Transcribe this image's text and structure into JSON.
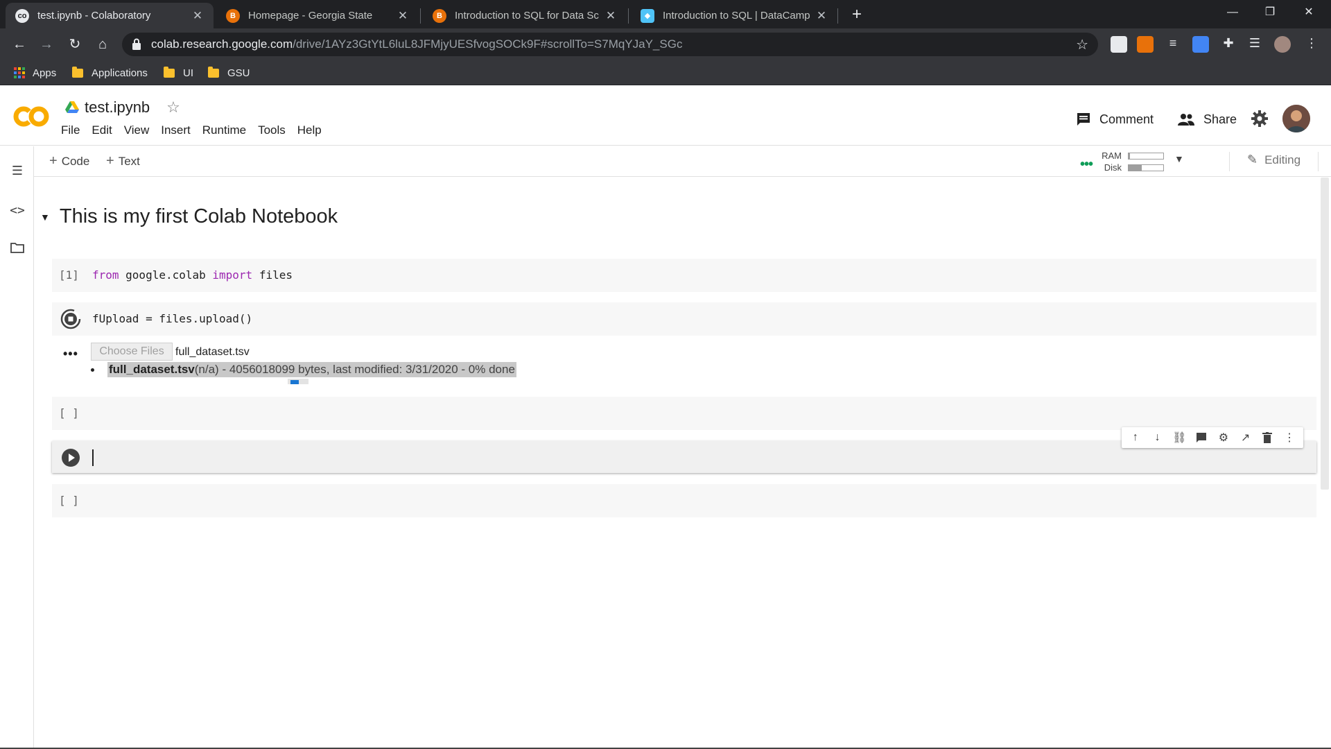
{
  "browser": {
    "tabs": [
      {
        "title": "test.ipynb - Colaboratory",
        "active": true
      },
      {
        "title": "Homepage - Georgia State",
        "active": false
      },
      {
        "title": "Introduction to SQL for Data Scie",
        "active": false
      },
      {
        "title": "Introduction to SQL | DataCamp",
        "active": false
      }
    ],
    "url": {
      "domain": "colab.research.google.com",
      "path": "/drive/1AYz3GtYtL6luL8JFMjyUESfvogSOCk9F#scrollTo=S7MqYJaY_SGc"
    },
    "bookmarks": [
      "Apps",
      "Applications",
      "UI",
      "GSU"
    ]
  },
  "colab": {
    "notebook_title": "test.ipynb",
    "menu": [
      "File",
      "Edit",
      "View",
      "Insert",
      "Runtime",
      "Tools",
      "Help"
    ],
    "comment_label": "Comment",
    "share_label": "Share",
    "add_code_label": "Code",
    "add_text_label": "Text",
    "ram_label": "RAM",
    "disk_label": "Disk",
    "ram_usage": 0.04,
    "disk_usage": 0.38,
    "editing_label": "Editing"
  },
  "notebook": {
    "section_heading": "This is my first Colab Notebook",
    "cells": [
      {
        "prompt": "[1]",
        "code_parts": [
          "from",
          " google.colab ",
          "import",
          " files"
        ]
      },
      {
        "code": "fUpload = files.upload()"
      },
      {
        "prompt": "[ ]",
        "code": ""
      },
      {
        "code": ""
      },
      {
        "prompt": "[ ]",
        "code": ""
      }
    ],
    "output": {
      "ellipsis": "•••",
      "choose_files_label": "Choose Files",
      "chosen_file": "full_dataset.tsv",
      "upload_filename": "full_dataset.tsv",
      "upload_details": "(n/a) - 4056018099 bytes, last modified: 3/31/2020 - 0% done"
    }
  },
  "colors": {
    "accent_orange": "#F9AB00",
    "keyword_purple": "#9C27B0",
    "progress_blue": "#1976D2",
    "status_green": "#0F9D58"
  }
}
